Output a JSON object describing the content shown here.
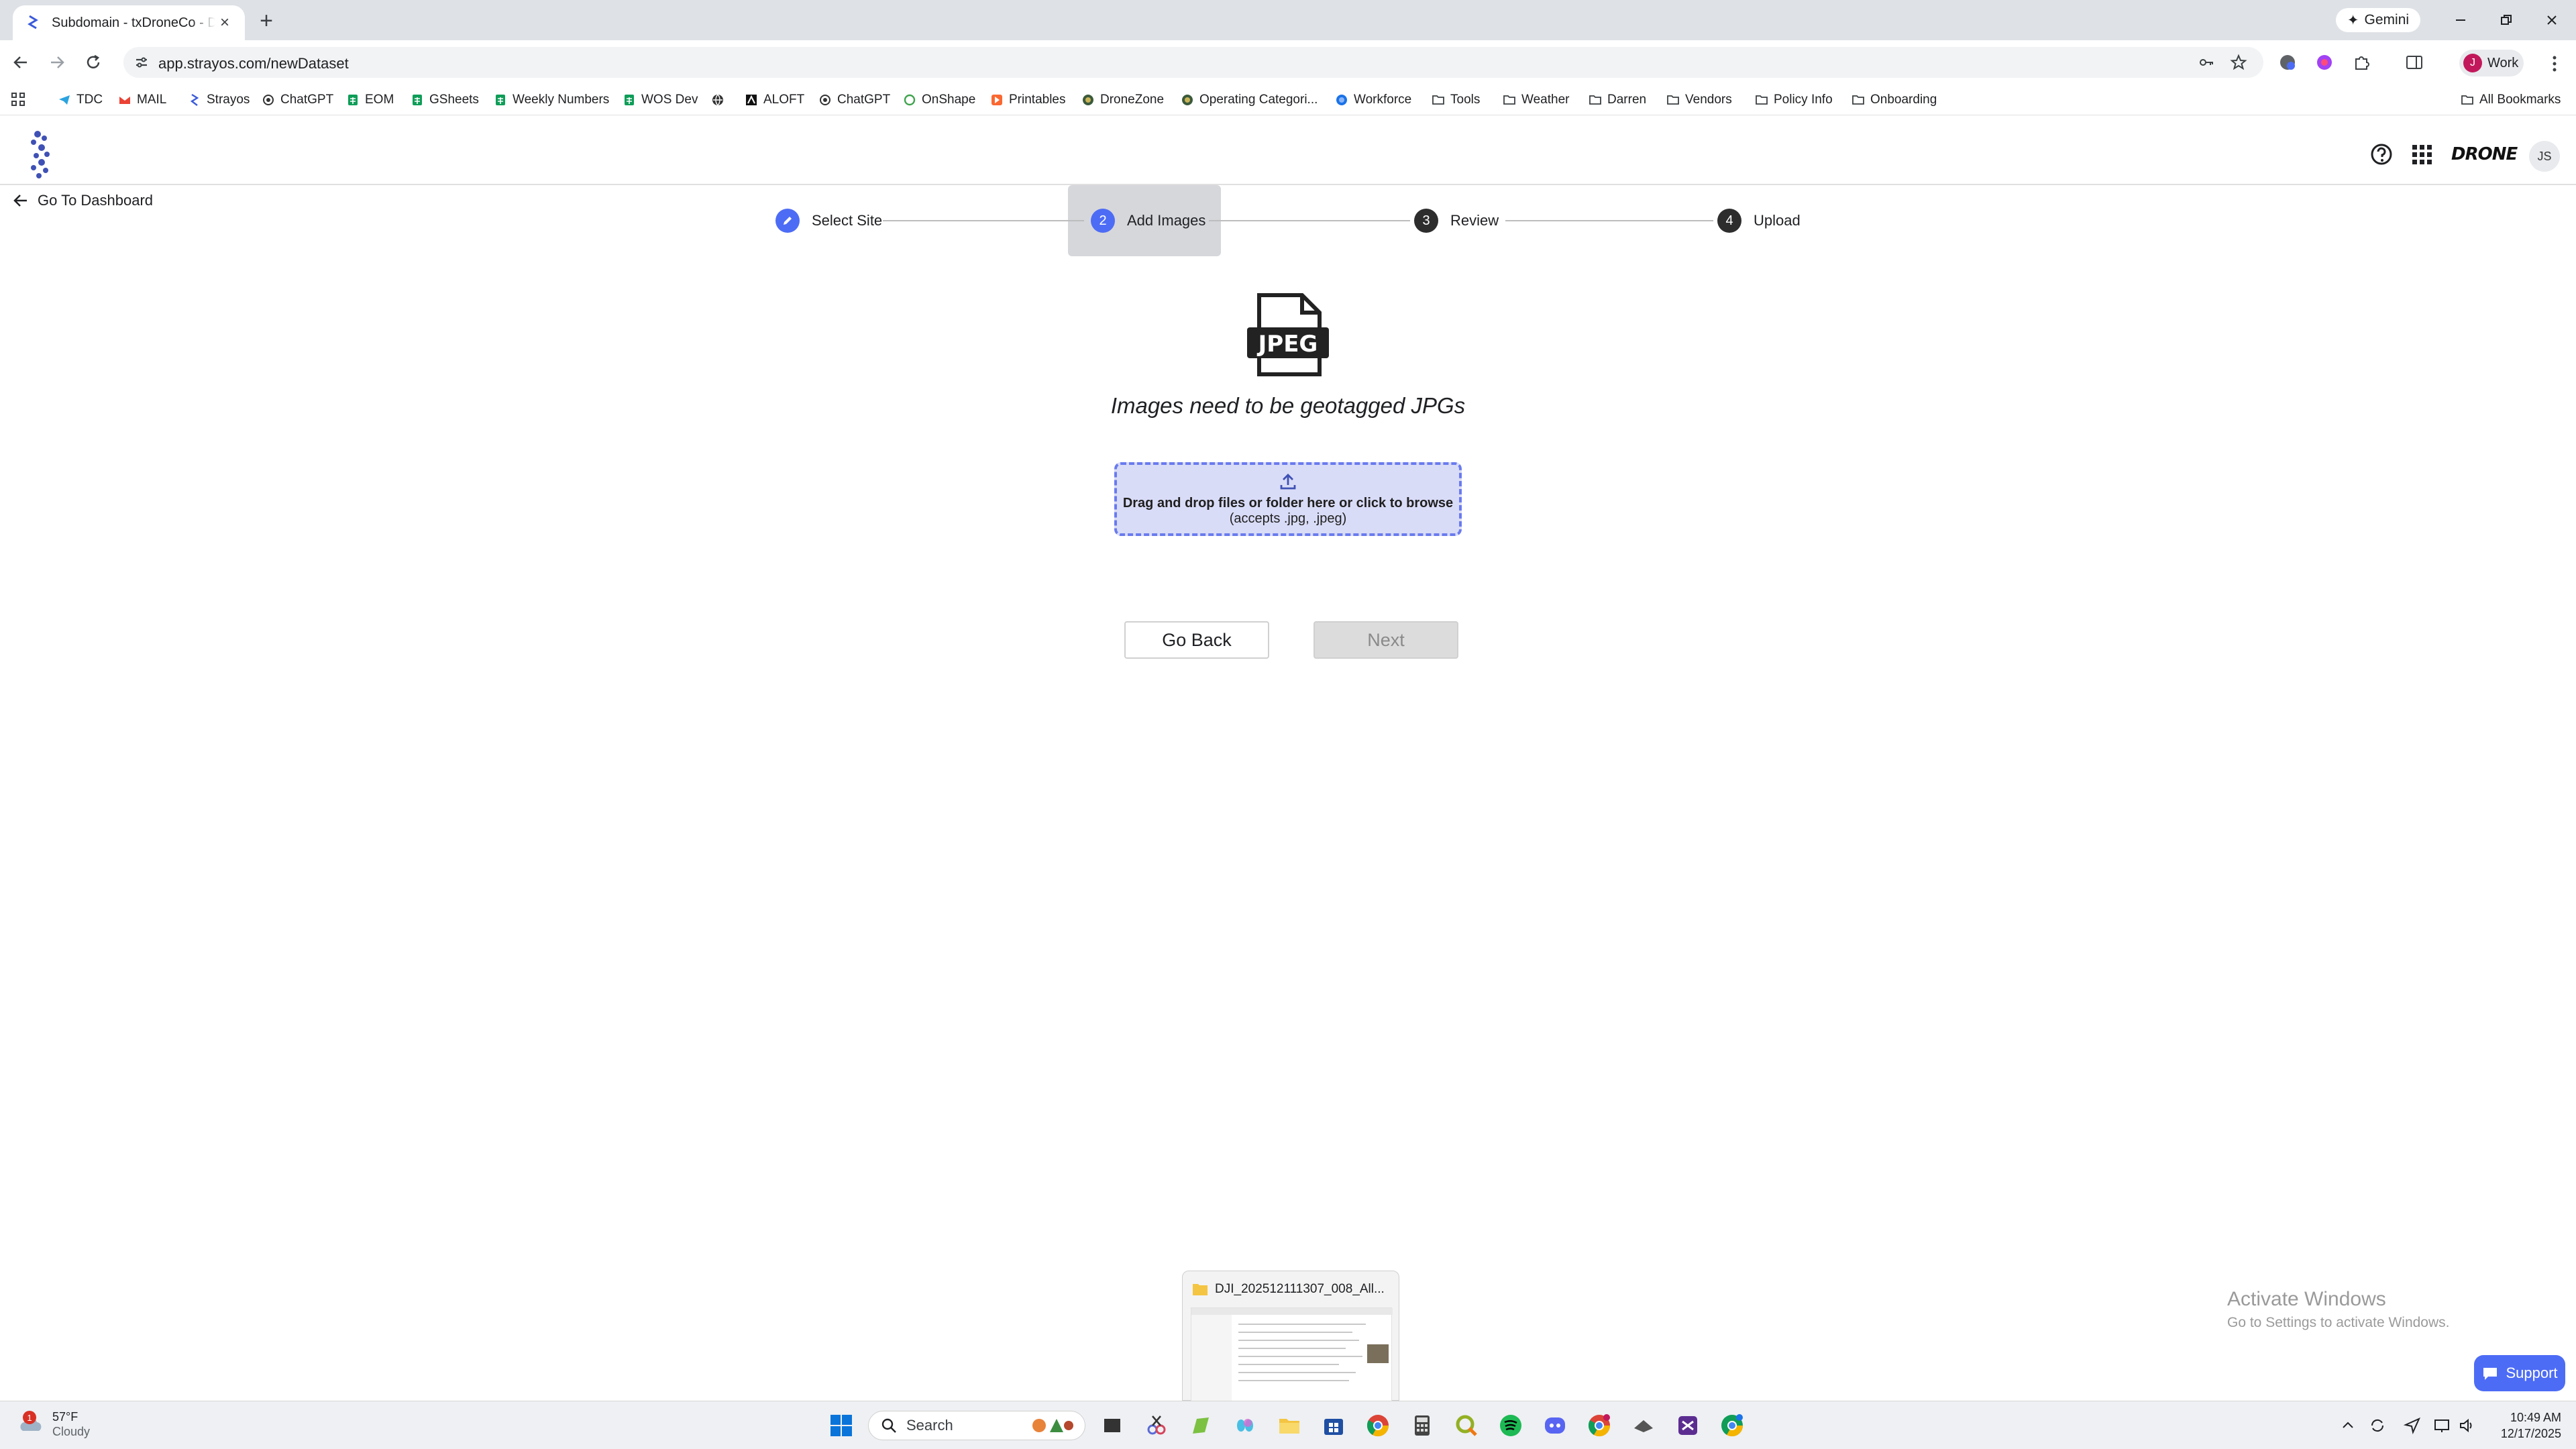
{
  "browser": {
    "tab": {
      "title": "Subdomain - txDroneCo - Dem",
      "close_glyph": "×"
    },
    "new_tab_glyph": "+",
    "gemini_label": "Gemini",
    "url": "app.strayos.com/newDataset",
    "profile": {
      "label": "Work",
      "initial": "J"
    },
    "bookmarks": [
      {
        "label": "TDC",
        "icon": "telegram-icon"
      },
      {
        "label": "MAIL",
        "icon": "gmail-icon"
      },
      {
        "label": "Strayos",
        "icon": "strayos-icon"
      },
      {
        "label": "ChatGPT",
        "icon": "chatgpt-icon"
      },
      {
        "label": "EOM",
        "icon": "sheets-icon"
      },
      {
        "label": "GSheets",
        "icon": "sheets-icon"
      },
      {
        "label": "Weekly Numbers",
        "icon": "sheets-icon"
      },
      {
        "label": "WOS Dev",
        "icon": "sheets-icon"
      },
      {
        "label": "",
        "icon": "globe-icon"
      },
      {
        "label": "ALOFT",
        "icon": "aloft-icon"
      },
      {
        "label": "ChatGPT",
        "icon": "chatgpt-icon"
      },
      {
        "label": "OnShape",
        "icon": "onshape-icon"
      },
      {
        "label": "Printables",
        "icon": "printables-icon"
      },
      {
        "label": "DroneZone",
        "icon": "faa-icon"
      },
      {
        "label": "Operating Categori...",
        "icon": "faa-icon"
      },
      {
        "label": "Workforce",
        "icon": "workforce-icon"
      },
      {
        "label": "Tools",
        "icon": "folder-icon"
      },
      {
        "label": "Weather",
        "icon": "folder-icon"
      },
      {
        "label": "Darren",
        "icon": "folder-icon"
      },
      {
        "label": "Vendors",
        "icon": "folder-icon"
      },
      {
        "label": "Policy Info",
        "icon": "folder-icon"
      },
      {
        "label": "Onboarding",
        "icon": "folder-icon"
      }
    ],
    "all_bookmarks": "All Bookmarks"
  },
  "app": {
    "go_dashboard": "Go To Dashboard",
    "brand_logo": "DRONE",
    "user_initials": "JS",
    "steps": [
      {
        "num": "",
        "label": "Select Site",
        "state": "done"
      },
      {
        "num": "2",
        "label": "Add Images",
        "state": "active"
      },
      {
        "num": "3",
        "label": "Review",
        "state": "pending"
      },
      {
        "num": "4",
        "label": "Upload",
        "state": "pending"
      }
    ],
    "jpeg_label": "JPEG",
    "hint": "Images need to be geotagged JPGs",
    "dropzone": {
      "main": "Drag and drop files or folder here or click to browse",
      "sub": "(accepts .jpg, .jpeg)"
    },
    "buttons": {
      "back": "Go Back",
      "next": "Next"
    },
    "accent_color": "#4d6cf5"
  },
  "overlays": {
    "activate_title": "Activate Windows",
    "activate_sub": "Go to Settings to activate Windows.",
    "support_label": "Support",
    "explorer_preview_title": "DJI_202512111307_008_All..."
  },
  "taskbar": {
    "weather_temp": "57°F",
    "weather_desc": "Cloudy",
    "weather_badge": "1",
    "search_placeholder": "Search",
    "time": "10:49 AM",
    "date": "12/17/2025"
  }
}
